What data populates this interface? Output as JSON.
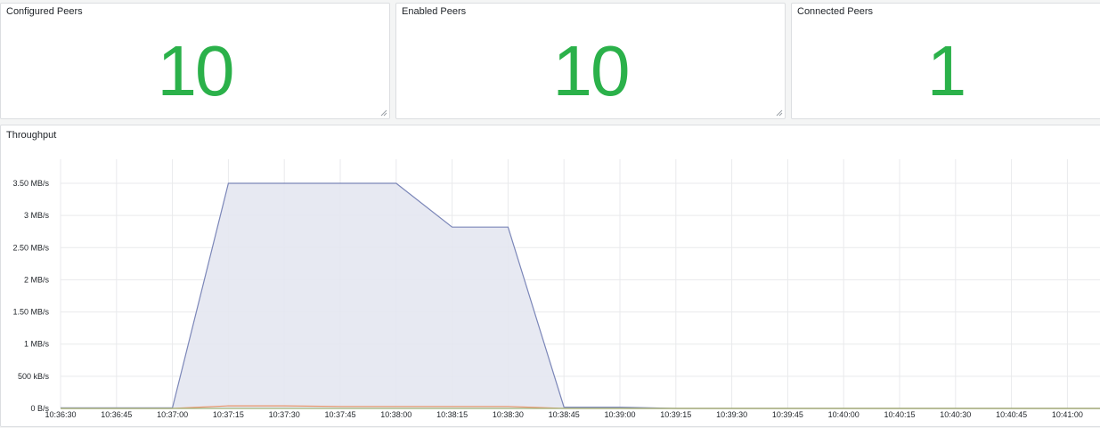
{
  "stats": [
    {
      "title": "Configured Peers",
      "value": "10"
    },
    {
      "title": "Enabled Peers",
      "value": "10"
    },
    {
      "title": "Connected Peers",
      "value": "1"
    }
  ],
  "colors": {
    "stat_value": "#2bb14a",
    "series_main": "#7b86b8",
    "series_main_fill": "#e4e7f1",
    "series_orange": "#e8946a",
    "series_green": "#9fb47a",
    "grid": "#e9eaec"
  },
  "chart": {
    "title": "Throughput",
    "icons": {
      "resize": "resize-corner-icon"
    }
  },
  "chart_data": {
    "type": "area",
    "title": "Throughput",
    "xlabel": "",
    "ylabel": "",
    "x_ticks": [
      "10:36:30",
      "10:36:45",
      "10:37:00",
      "10:37:15",
      "10:37:30",
      "10:37:45",
      "10:38:00",
      "10:38:15",
      "10:38:30",
      "10:38:45",
      "10:39:00",
      "10:39:15",
      "10:39:30",
      "10:39:45",
      "10:40:00",
      "10:40:15",
      "10:40:30",
      "10:40:45",
      "10:41:00"
    ],
    "y_ticks": [
      "0 B/s",
      "500 kB/s",
      "1 MB/s",
      "1.50 MB/s",
      "2 MB/s",
      "2.50 MB/s",
      "3 MB/s",
      "3.50 MB/s"
    ],
    "ylim": [
      0,
      3.5
    ],
    "y_unit": "MB/s",
    "x": [
      "10:36:30",
      "10:36:45",
      "10:37:00",
      "10:37:15",
      "10:37:30",
      "10:37:45",
      "10:38:00",
      "10:38:15",
      "10:38:30",
      "10:38:45",
      "10:39:00",
      "10:39:15",
      "10:39:30",
      "10:39:45",
      "10:40:00",
      "10:40:15",
      "10:40:30",
      "10:40:45",
      "10:41:00",
      "10:41:10"
    ],
    "series": [
      {
        "values": [
          0.01,
          0.01,
          0.01,
          3.5,
          3.5,
          3.5,
          3.5,
          2.82,
          2.82,
          0.02,
          0.02,
          0.0,
          0.0,
          0.0,
          0.0,
          0.0,
          0.0,
          0.0,
          0.0,
          0.0
        ],
        "style": "main"
      },
      {
        "values": [
          0.0,
          0.0,
          0.0,
          0.04,
          0.04,
          0.03,
          0.03,
          0.03,
          0.03,
          0.0,
          0.0,
          0.0,
          0.0,
          0.0,
          0.0,
          0.0,
          0.0,
          0.0,
          0.0,
          0.0
        ],
        "style": "orange"
      },
      {
        "values": [
          0.0,
          0.0,
          0.0,
          0.0,
          0.0,
          0.0,
          0.0,
          0.0,
          0.0,
          0.0,
          0.0,
          0.0,
          0.0,
          0.0,
          0.0,
          0.0,
          0.0,
          0.0,
          0.0,
          0.0
        ],
        "style": "green"
      }
    ],
    "grid": true,
    "legend": "none"
  }
}
